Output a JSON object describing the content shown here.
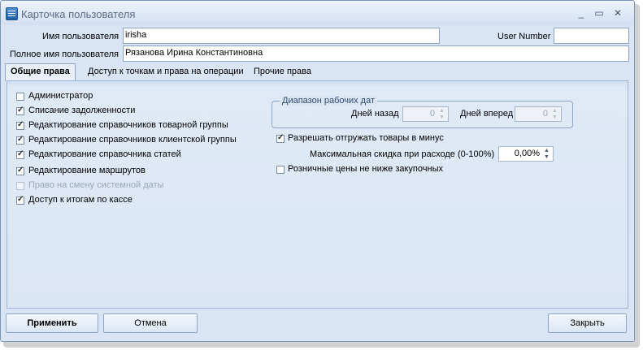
{
  "window": {
    "title": "Карточка пользователя",
    "min_glyph": "_",
    "max_glyph": "▭",
    "close_glyph": "✕"
  },
  "header": {
    "username_label": "Имя пользователя",
    "username_value": "irisha",
    "usernumber_label": "User Number",
    "usernumber_value": "",
    "fullname_label": "Полное имя пользователя",
    "fullname_value": "Рязанова Ирина Константиновна"
  },
  "tabs": [
    {
      "label": "Общие права",
      "active": true
    },
    {
      "label": "Доступ к точкам и права на операции",
      "active": false
    },
    {
      "label": "Прочие права",
      "active": false
    }
  ],
  "rights": [
    {
      "label": "Администратор",
      "checked": false,
      "enabled": true
    },
    {
      "label": "Списание задолженности",
      "checked": true,
      "enabled": true
    },
    {
      "label": "Редактирование справочников товарной группы",
      "checked": true,
      "enabled": true
    },
    {
      "label": "Редактирование справочников клиентской группы",
      "checked": true,
      "enabled": true
    },
    {
      "label": "Редактирование справочника статей",
      "checked": true,
      "enabled": true
    },
    {
      "label": "Редактирование маршрутов",
      "checked": true,
      "enabled": true
    },
    {
      "label": "Право на смену системной даты",
      "checked": false,
      "enabled": false
    },
    {
      "label": "Доступ к итогам по кассе",
      "checked": true,
      "enabled": true
    }
  ],
  "date_range": {
    "title": "Диапазон рабочих дат",
    "days_back_label": "Дней назад",
    "days_back_value": "0",
    "days_forward_label": "Дней вперед",
    "days_forward_value": "0"
  },
  "options": {
    "allow_negative_label": "Разрешать отгружать товары в минус",
    "allow_negative_checked": true,
    "max_discount_label": "Максимальная скидка при расходе (0-100%)",
    "max_discount_value": "0,00%",
    "retail_price_label": "Розничные цены не ниже закупочных",
    "retail_price_checked": false
  },
  "buttons": {
    "apply": "Применить",
    "cancel": "Отмена",
    "close": "Закрыть"
  },
  "icons": {
    "spin_up": "▲",
    "spin_down": "▼"
  }
}
